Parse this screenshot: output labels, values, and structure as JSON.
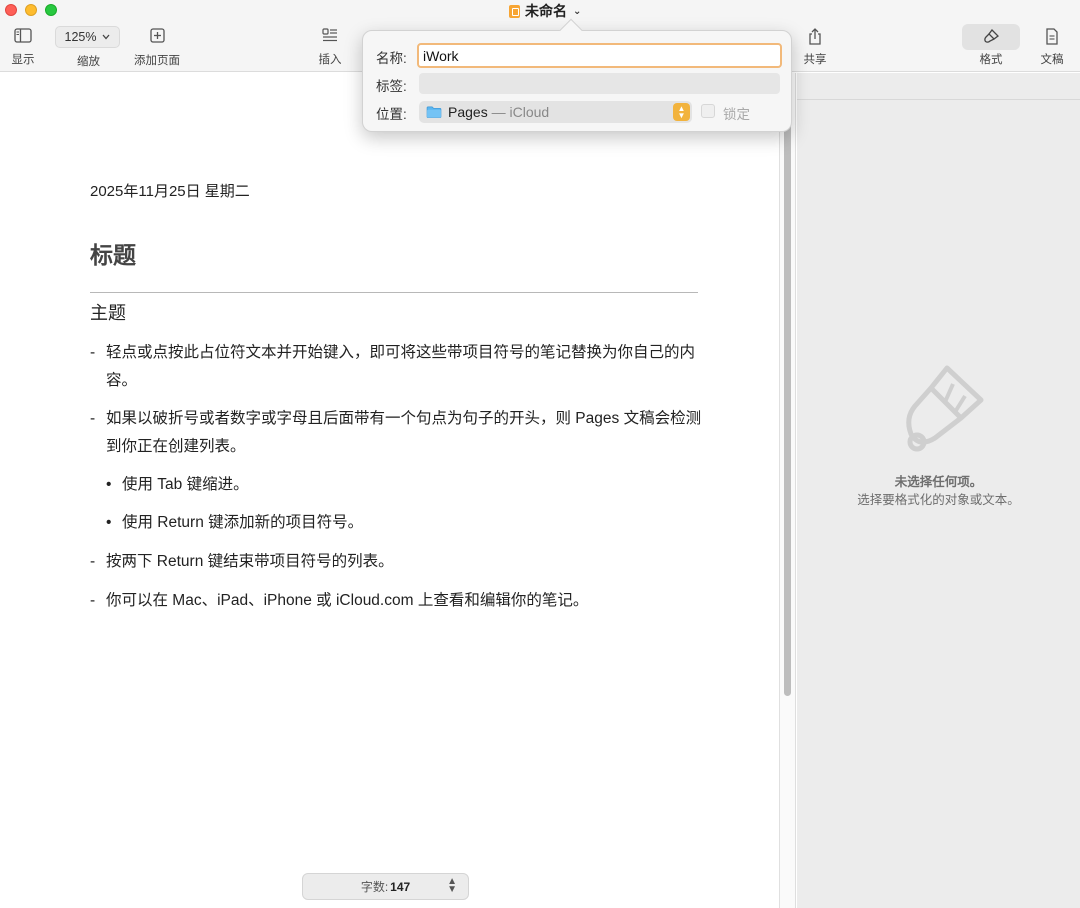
{
  "window": {
    "title": "未命名",
    "title_chevron": "⌄"
  },
  "toolbar": {
    "view_label": "显示",
    "zoom_value": "125%",
    "zoom_label": "缩放",
    "add_page_label": "添加页面",
    "insert_label": "插入",
    "share_label": "共享",
    "format_label": "格式",
    "document_label": "文稿"
  },
  "popover": {
    "name_label": "名称:",
    "name_value": "iWork",
    "tags_label": "标签:",
    "tags_value": "",
    "location_label": "位置:",
    "location_value": "Pages",
    "location_sub": " — iCloud",
    "lock_label": "锁定",
    "lock_checked": false
  },
  "document": {
    "date": "2025年11月25日 星期二",
    "heading": "标题",
    "subheading": "主题",
    "items": [
      {
        "marker": "-",
        "text": "轻点或点按此占位符文本并开始键入，即可将这些带项目符号的笔记替换为你自己的内容。"
      },
      {
        "marker": "-",
        "text": "如果以破折号或者数字或字母且后面带有一个句点为句子的开头，则 Pages 文稿会检测到你正在创建列表。"
      },
      {
        "marker": "•",
        "text": "使用 Tab 键缩进。"
      },
      {
        "marker": "•",
        "text": "使用 Return 键添加新的项目符号。"
      },
      {
        "marker": "-",
        "text": "按两下 Return 键结束带项目符号的列表。"
      },
      {
        "marker": "-",
        "text": "你可以在 Mac、iPad、iPhone 或 iCloud.com 上查看和编辑你的笔记。"
      }
    ]
  },
  "status": {
    "word_count_label": "字数:",
    "word_count_value": "147"
  },
  "inspector": {
    "empty_title": "未选择任何项。",
    "empty_subtitle": "选择要格式化的对象或文本。"
  },
  "icons": {
    "view": "sidebar-icon",
    "add_page": "plus-square-icon",
    "insert": "insert-text-icon",
    "share": "share-icon",
    "format": "paintbrush-icon",
    "document": "document-icon",
    "folder": "folder-icon"
  },
  "colors": {
    "accent": "#f2b33d",
    "focus_ring": "#f2b97a",
    "close": "#fe5f57",
    "minimize": "#febc2e",
    "zoom": "#28c840"
  }
}
